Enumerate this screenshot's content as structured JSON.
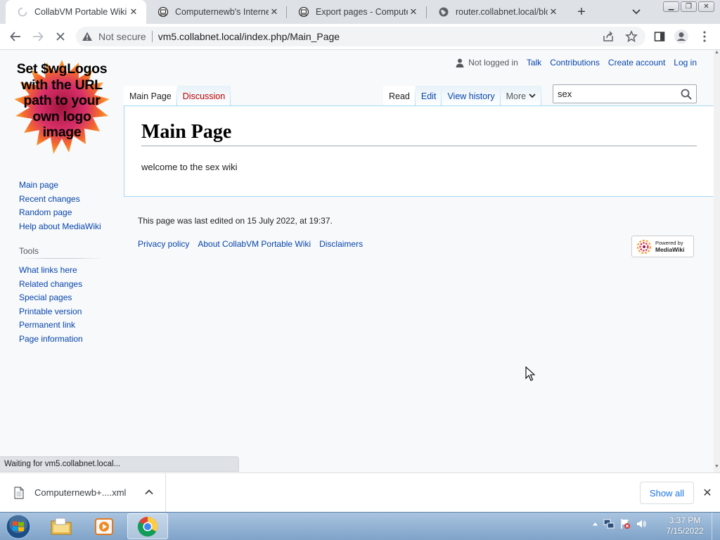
{
  "browser": {
    "tabs": [
      {
        "title": "CollabVM Portable Wiki",
        "active": true
      },
      {
        "title": "Computernewb's Internet",
        "active": false
      },
      {
        "title": "Export pages - Computer",
        "active": false
      },
      {
        "title": "router.collabnet.local/blo",
        "active": false
      }
    ],
    "address": {
      "security": "Not secure",
      "url": "vm5.collabnet.local/index.php/Main_Page"
    }
  },
  "wiki": {
    "logo_text": "Set $wgLogos with the URL path to your own logo image",
    "personal": {
      "user": "Not logged in",
      "links": [
        "Talk",
        "Contributions",
        "Create account",
        "Log in"
      ]
    },
    "namespace_tabs": {
      "page": "Main Page",
      "talk": "Discussion"
    },
    "view_tabs": {
      "read": "Read",
      "edit": "Edit",
      "history": "View history",
      "more": "More"
    },
    "search_value": "sex",
    "heading": "Main Page",
    "body": "welcome to the sex wiki",
    "nav": [
      "Main page",
      "Recent changes",
      "Random page",
      "Help about MediaWiki"
    ],
    "tools": {
      "title": "Tools",
      "items": [
        "What links here",
        "Related changes",
        "Special pages",
        "Printable version",
        "Permanent link",
        "Page information"
      ]
    },
    "footer": {
      "last_edited": "This page was last edited on 15 July 2022, at 19:37.",
      "links": [
        "Privacy policy",
        "About CollabVM Portable Wiki",
        "Disclaimers"
      ],
      "powered": {
        "line1": "Powered by",
        "line2": "MediaWiki"
      }
    }
  },
  "status_text": "Waiting for vm5.collabnet.local...",
  "download": {
    "file": "Computernewb+....xml",
    "show_all": "Show all"
  },
  "taskbar": {
    "time": "3:37 PM",
    "date": "7/15/2022"
  },
  "colors": {
    "link": "#0645ad",
    "redlink": "#ba0000",
    "accent_border": "#a7d7f9",
    "chrome_blue": "#1a73e8"
  }
}
